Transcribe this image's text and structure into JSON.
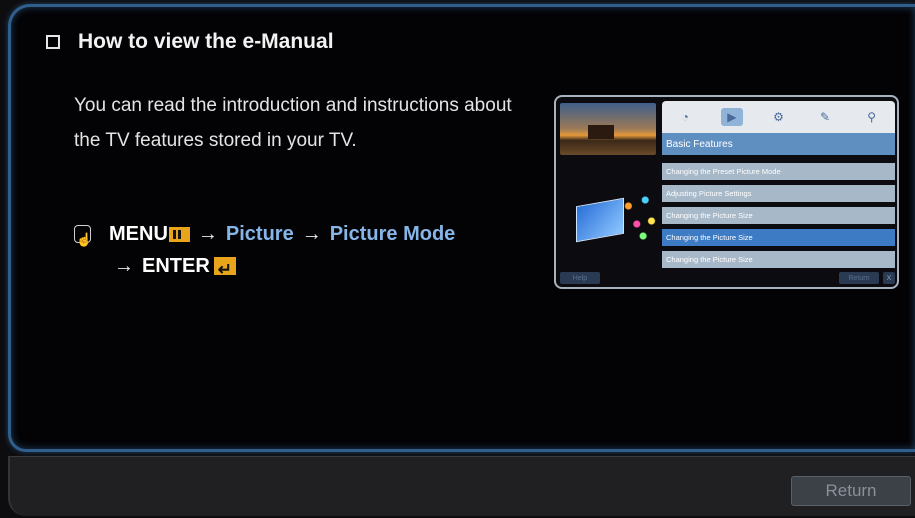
{
  "heading": "How to view the e-Manual",
  "body_text": "You can read the introduction and instructions about the TV features stored in your TV.",
  "menu_path": {
    "menu": "MENU",
    "picture": "Picture",
    "picture_mode": "Picture Mode",
    "enter": "ENTER",
    "arrow": "→"
  },
  "footer": {
    "return_label": "Return"
  },
  "thumbnail": {
    "title": "Basic Features",
    "items": [
      "Changing the Preset Picture Mode",
      "Adjusting Picture Settings",
      "Changing the Picture Size",
      "Changing the Picture Size",
      "Changing the Picture Size"
    ],
    "help": "Help",
    "return": "Return",
    "close": "X"
  },
  "colors": {
    "accent": "#e8a51b",
    "link": "#86b6e8",
    "border": "#2f5f8c"
  }
}
